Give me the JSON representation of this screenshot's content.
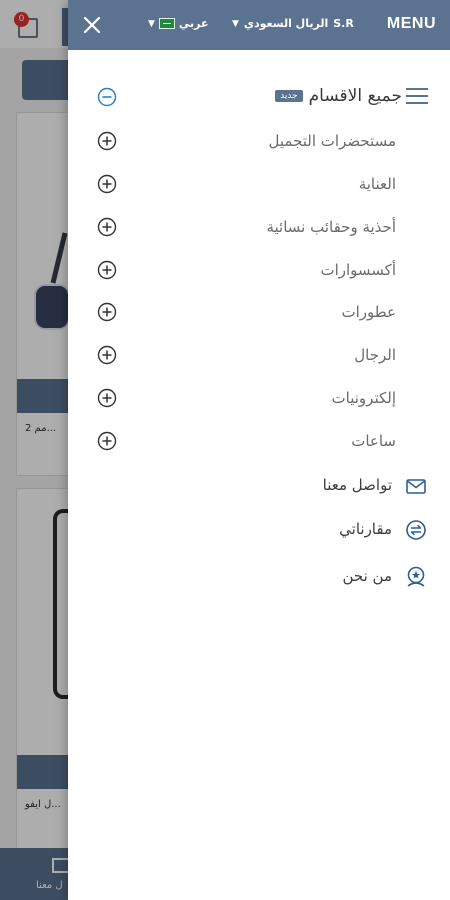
{
  "background": {
    "cart_badge": "0",
    "card1_text": "2 مم...",
    "card2_text": "ل ايفو...",
    "bottom_nav_label": "ل معنا"
  },
  "drawer": {
    "menu_label": "MENU",
    "currency_symbol": "S.R",
    "currency_name": "الريال السعودي",
    "language": "عربي",
    "all_categories": {
      "label": "جميع الاقسام",
      "badge": "جديد"
    },
    "categories": [
      {
        "label": "مستحضرات التجميل"
      },
      {
        "label": "العناية"
      },
      {
        "label": "أحذية وحقائب نسائية"
      },
      {
        "label": "أكسسوارات"
      },
      {
        "label": "عطورات"
      },
      {
        "label": "الرجال"
      },
      {
        "label": "إلكترونيات"
      },
      {
        "label": "ساعات"
      }
    ],
    "links": [
      {
        "label": "تواصل معنا",
        "icon": "envelope-icon"
      },
      {
        "label": "مقارناتي",
        "icon": "compare-icon"
      },
      {
        "label": "من نحن",
        "icon": "about-badge-icon"
      }
    ]
  },
  "colors": {
    "header": "#5b7290",
    "accent": "#2f7fc2",
    "badge_red": "#e23131"
  }
}
